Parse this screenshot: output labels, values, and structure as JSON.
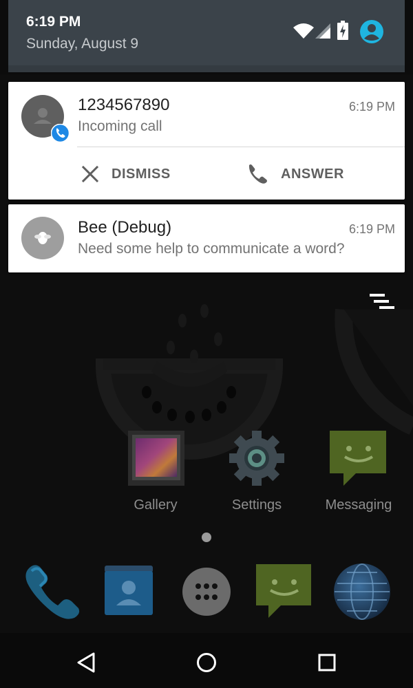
{
  "status": {
    "time": "6:19 PM",
    "date": "Sunday, August 9",
    "icons": [
      "wifi-icon",
      "cell-signal-icon",
      "battery-charging-icon",
      "account-icon"
    ],
    "accent_color": "#1fb5e0"
  },
  "notifications": [
    {
      "title": "1234567890",
      "text": "Incoming call",
      "time": "6:19 PM",
      "icon": "contact-avatar-icon",
      "badge_icon": "phone-badge-icon",
      "actions": [
        {
          "label": "DISMISS",
          "icon": "close-icon"
        },
        {
          "label": "ANSWER",
          "icon": "phone-icon"
        }
      ]
    },
    {
      "title": "Bee (Debug)",
      "text": "Need some help to communicate a word?",
      "time": "6:19 PM",
      "icon": "bee-app-icon"
    }
  ],
  "home": {
    "apps": [
      {
        "label": "Gallery",
        "icon": "gallery-icon"
      },
      {
        "label": "Settings",
        "icon": "settings-icon"
      },
      {
        "label": "Messaging",
        "icon": "messaging-icon"
      }
    ],
    "dock": [
      "phone-icon",
      "contacts-icon",
      "app-drawer-icon",
      "messaging-icon",
      "browser-icon"
    ]
  },
  "navbar": [
    "back-icon",
    "home-icon",
    "recents-icon"
  ]
}
